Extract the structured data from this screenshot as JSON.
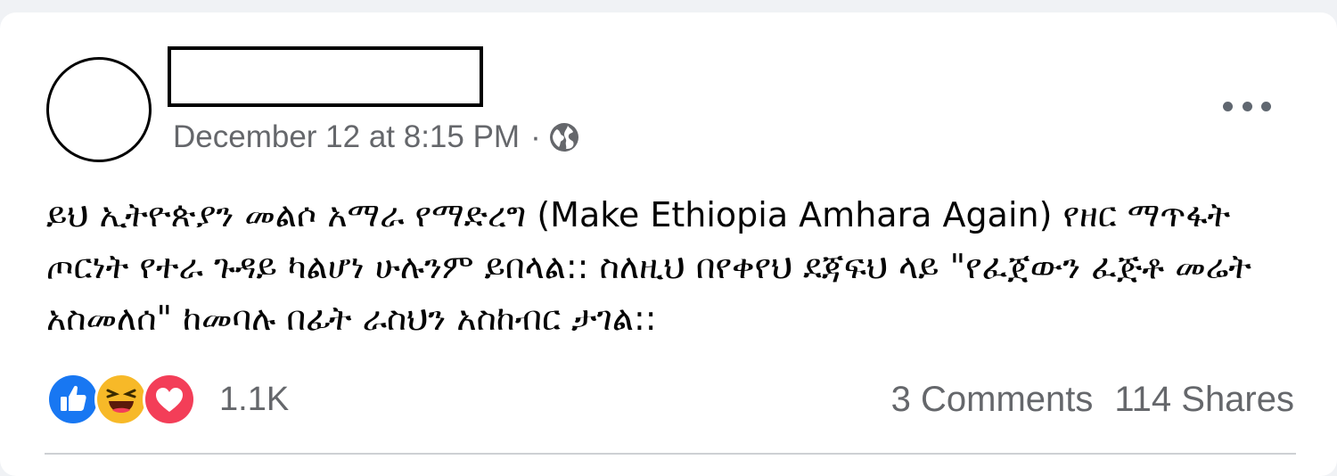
{
  "post": {
    "timestamp": "December 12 at 8:15 PM",
    "separator": "·",
    "audience_icon": "globe-icon",
    "more_icon": "more-options-icon",
    "body_text": "ይህ ኢትዮጵያን መልሶ አማራ የማድረግ (Make Ethiopia Amhara Again) የዘር ማጥፋት ጦርነት የተራ ጉዳይ ካልሆነ ሁሉንም ይበላል:: ስለዚህ በየቀየህ ደጃፍህ ላይ \"የፈጀውን ፈጅቶ መሬት አስመለሰ\" ከመባሉ በፊት ራስህን አስከብር ታገል::"
  },
  "reactions": {
    "icons": [
      "like-icon",
      "haha-icon",
      "love-icon"
    ],
    "count": "1.1K"
  },
  "stats": {
    "comments": "3 Comments",
    "shares": "114 Shares"
  },
  "colors": {
    "like": "#1877f2",
    "haha": "#f7b928",
    "love": "#f33e58",
    "meta_text": "#65676b",
    "body_text": "#050505"
  }
}
